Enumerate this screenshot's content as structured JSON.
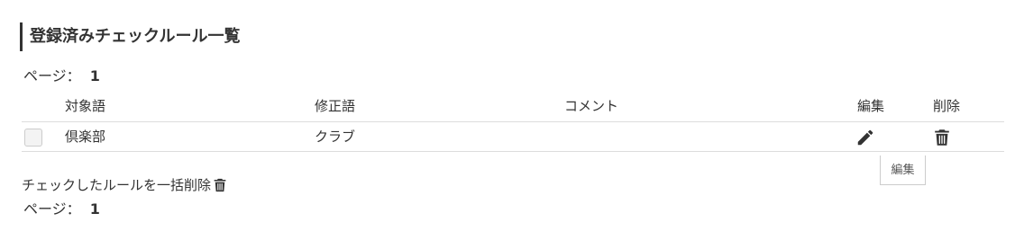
{
  "header": {
    "title": "登録済みチェックルール一覧"
  },
  "pager_top": {
    "label": "ページ：",
    "page": "1"
  },
  "table": {
    "columns": {
      "target": "対象語",
      "fix": "修正語",
      "comment": "コメント",
      "edit": "編集",
      "delete": "削除"
    },
    "rows": [
      {
        "target": "倶楽部",
        "fix": "クラブ",
        "comment": ""
      }
    ]
  },
  "tooltip": {
    "text": "編集"
  },
  "bulk": {
    "delete_label": "チェックしたルールを一括削除"
  },
  "pager_bottom": {
    "label": "ページ：",
    "page": "1"
  },
  "icons": {
    "edit": "pencil-icon",
    "delete": "trash-icon",
    "bulk_delete": "trash-icon"
  }
}
